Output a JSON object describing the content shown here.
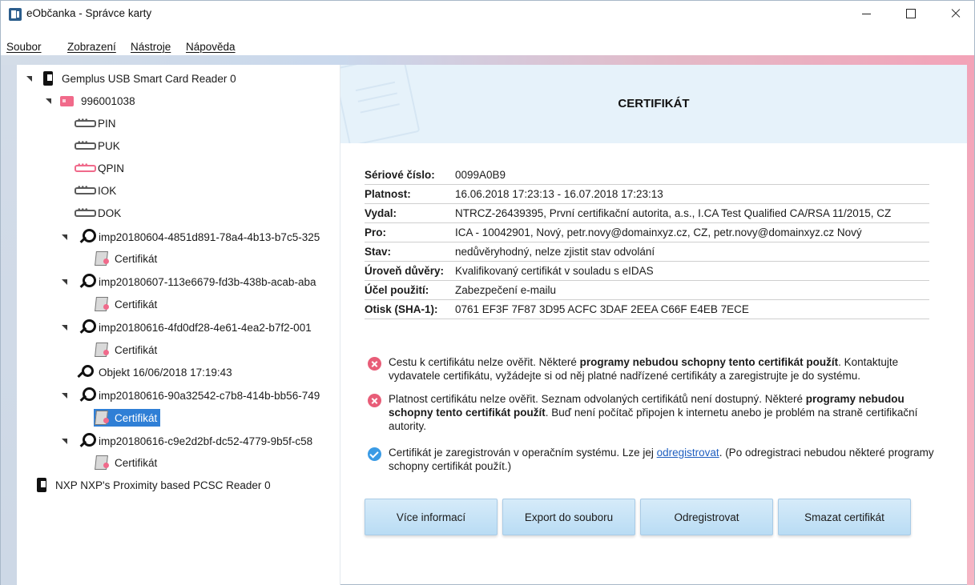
{
  "window": {
    "title": "eObčanka - Správce karty"
  },
  "menu": [
    "Soubor",
    "Zobrazení",
    "Nástroje",
    "Nápověda"
  ],
  "tree": {
    "reader1": "Gemplus USB Smart Card Reader 0",
    "card": "996001038",
    "pins": [
      "PIN",
      "PUK",
      "QPIN",
      "IOK",
      "DOK"
    ],
    "keys": [
      {
        "label": "imp20180604-4851d891-78a4-4b13-b7c5-325",
        "cert": "Certifikát"
      },
      {
        "label": "imp20180607-113e6679-fd3b-438b-acab-aba",
        "cert": "Certifikát"
      },
      {
        "label": "imp20180616-4fd0df28-4e61-4ea2-b7f2-001",
        "cert": "Certifikát"
      }
    ],
    "object": "Objekt 16/06/2018 17:19:43",
    "keys2": [
      {
        "label": "imp20180616-90a32542-c7b8-414b-bb56-749",
        "cert": "Certifikát"
      },
      {
        "label": "imp20180616-c9e2d2bf-dc52-4779-9b5f-c58",
        "cert": "Certifikát"
      }
    ],
    "reader2": "NXP NXP's Proximity based PCSC Reader 0"
  },
  "main": {
    "title": "CERTIFIKÁT",
    "details": [
      {
        "label": "Sériové číslo:",
        "value": "0099A0B9"
      },
      {
        "label": "Platnost:",
        "value": "16.06.2018 17:23:13 - 16.07.2018 17:23:13"
      },
      {
        "label": "Vydal:",
        "value": "NTRCZ-26439395, První certifikační autorita, a.s., I.CA Test Qualified CA/RSA 11/2015, CZ"
      },
      {
        "label": "Pro:",
        "value": "ICA - 10042901, Nový, petr.novy@domainxyz.cz, CZ, petr.novy@domainxyz.cz Nový"
      },
      {
        "label": "Stav:",
        "value": "nedůvěryhodný, nelze zjistit stav odvolání"
      },
      {
        "label": "Úroveň důvěry:",
        "value": "Kvalifikovaný certifikát v souladu s eIDAS"
      },
      {
        "label": "Účel použití:",
        "value": "Zabezpečení e-mailu"
      },
      {
        "label": "Otisk (SHA-1):",
        "value": "0761 EF3F 7F87 3D95 ACFC 3DAF 2EEA C66F E4EB 7ECE"
      }
    ],
    "messages": {
      "m1_a": "Cestu k certifikátu nelze ověřit. Některé ",
      "m1_b": "programy nebudou schopny tento certifikát použít",
      "m1_c": ". Kontaktujte vydavatele certifikátu, vyžádejte si od něj platné nadřízené certifikáty a zaregistrujte je do systému.",
      "m2_a": "Platnost certifikátu nelze ověřit. Seznam odvolaných certifikátů není dostupný. Některé ",
      "m2_b": "programy nebudou schopny tento certifikát použít",
      "m2_c": ". Buď není počítač připojen k internetu anebo je problém na straně certifikační autority.",
      "m3_a": "Certifikát je zaregistrován v operačním systému. Lze jej ",
      "m3_link": "odregistrovat",
      "m3_c": ". (Po odregistraci nebudou některé programy schopny certifikát použít.)"
    },
    "buttons": {
      "more_info": "Více informací",
      "export": "Export do souboru",
      "unregister": "Odregistrovat",
      "delete": "Smazat certifikát"
    }
  }
}
